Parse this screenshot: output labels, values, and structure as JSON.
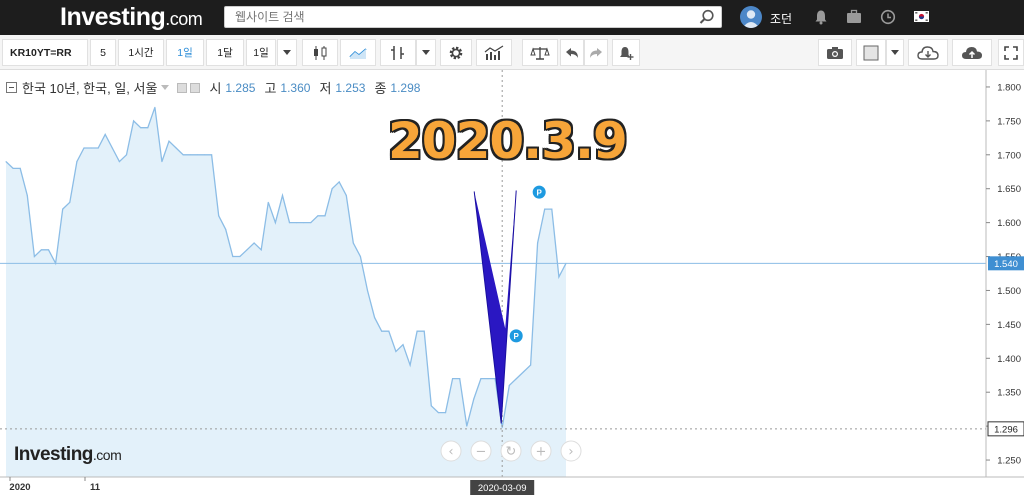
{
  "header": {
    "logo_main": "Investing",
    "logo_suffix": ".com",
    "search_placeholder": "웹사이트 검색",
    "username": "조던"
  },
  "toolbar": {
    "symbol": "KR10YT=RR",
    "intervals": [
      "5",
      "1시간",
      "1일",
      "1달",
      "1일"
    ],
    "active_interval": "1일",
    "icons": [
      "dropdown-icon",
      "candlestick-icon",
      "line-chart-icon",
      "bar-chart-icon",
      "dropdown-icon",
      "gear-icon",
      "indicators-icon",
      "balance-icon",
      "undo-icon",
      "redo-icon",
      "alert-icon",
      "camera-icon",
      "color-box-icon",
      "dropdown-icon",
      "cloud-download-icon",
      "cloud-upload-icon",
      "fullscreen-icon"
    ]
  },
  "legend": {
    "title": "한국 10년, 한국, 일, 서울",
    "open_label": "시",
    "open": "1.285",
    "high_label": "고",
    "high": "1.360",
    "low_label": "저",
    "low": "1.253",
    "close_label": "종",
    "close": "1.298"
  },
  "annotation": "2020.3.9",
  "watermark": {
    "main": "Investing",
    "suffix": ".com"
  },
  "chart_data": {
    "type": "area",
    "title": "한국 10년, 한국, 일, 서울",
    "x_tick_labels": [
      "2020",
      "11"
    ],
    "crosshair_label": "2020-03-09",
    "ylim": [
      1.225,
      1.825
    ],
    "y_ticks": [
      1.25,
      1.3,
      1.35,
      1.4,
      1.45,
      1.5,
      1.55,
      1.6,
      1.65,
      1.7,
      1.75,
      1.8
    ],
    "y_tick_labels": [
      "1.250",
      "1.300",
      "1.350",
      "1.400",
      "1.450",
      "1.500",
      "1.550",
      "1.600",
      "1.650",
      "1.700",
      "1.750",
      "1.800"
    ],
    "price_line": {
      "value": 1.54,
      "label": "1.540"
    },
    "crosshair_value": {
      "value": 1.296,
      "label": "1.296"
    },
    "grid": false,
    "series": [
      {
        "values": [
          1.69,
          1.68,
          1.68,
          1.64,
          1.55,
          1.56,
          1.56,
          1.54,
          1.62,
          1.63,
          1.69,
          1.71,
          1.71,
          1.71,
          1.73,
          1.71,
          1.69,
          1.7,
          1.75,
          1.74,
          1.74,
          1.77,
          1.69,
          1.72,
          1.71,
          1.7,
          1.7,
          1.7,
          1.7,
          1.7,
          1.61,
          1.59,
          1.55,
          1.55,
          1.56,
          1.57,
          1.56,
          1.63,
          1.6,
          1.64,
          1.6,
          1.6,
          1.6,
          1.6,
          1.61,
          1.61,
          1.65,
          1.66,
          1.64,
          1.57,
          1.55,
          1.5,
          1.46,
          1.44,
          1.44,
          1.41,
          1.42,
          1.39,
          1.44,
          1.44,
          1.33,
          1.32,
          1.32,
          1.37,
          1.37,
          1.3,
          1.34,
          1.37,
          1.37,
          1.37,
          1.298,
          1.36,
          1.37,
          1.38,
          1.39,
          1.57,
          1.62,
          1.62,
          1.52,
          1.54
        ]
      }
    ],
    "markers": [
      "P",
      "P"
    ],
    "colors": {
      "line": "#8cbde6",
      "fill": "#e3f1fa",
      "arrow": "#2a17c2",
      "annotation": "#f7a539",
      "marker": "#1e9ae0"
    }
  }
}
